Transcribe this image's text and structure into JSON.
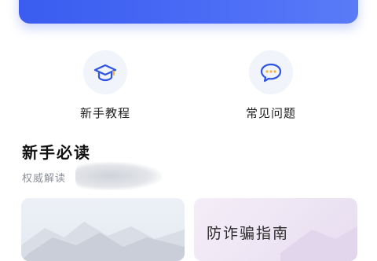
{
  "quick_links": [
    {
      "label": "新手教程",
      "icon": "graduation-cap-icon"
    },
    {
      "label": "常见问题",
      "icon": "chat-bubble-icon"
    }
  ],
  "section": {
    "title": "新手必读",
    "subtitle": "权威解读"
  },
  "cards": [
    {
      "title": ""
    },
    {
      "title": "防诈骗指南"
    }
  ],
  "colors": {
    "accent": "#3a5cf0",
    "icon_bg": "#f1f4fb"
  }
}
